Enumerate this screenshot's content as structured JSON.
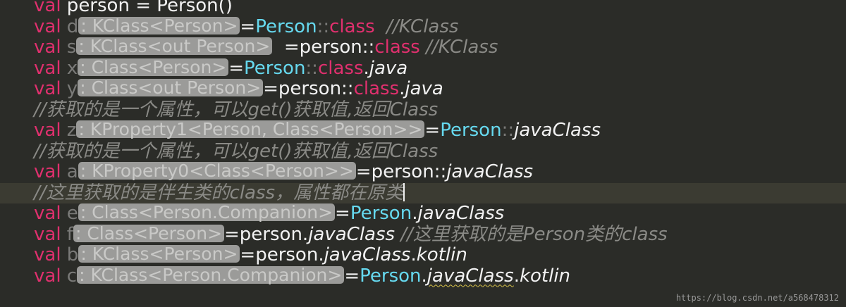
{
  "editor": {
    "lines": [
      {
        "tokens": [
          {
            "t": "val",
            "c": "kw"
          },
          {
            "t": " person = ",
            "c": "op"
          },
          {
            "t": "Person()",
            "c": "op"
          }
        ]
      },
      {
        "tokens": [
          {
            "t": "val",
            "c": "kw"
          },
          {
            "t": " d",
            "c": "dim"
          },
          {
            "t": ": KClass<Person>",
            "c": "hint"
          },
          {
            "t": "=",
            "c": "op"
          },
          {
            "t": "Person",
            "c": "type"
          },
          {
            "t": "::",
            "c": "dim"
          },
          {
            "t": "class",
            "c": "kw"
          },
          {
            "t": "  //KClass",
            "c": "cmt"
          }
        ]
      },
      {
        "tokens": [
          {
            "t": "val",
            "c": "kw"
          },
          {
            "t": " s",
            "c": "dim"
          },
          {
            "t": ": KClass<out Person>",
            "c": "hint"
          },
          {
            "t": "  =person::",
            "c": "op"
          },
          {
            "t": "class",
            "c": "kw"
          },
          {
            "t": " //KClass",
            "c": "cmt"
          }
        ]
      },
      {
        "tokens": [
          {
            "t": "val",
            "c": "kw"
          },
          {
            "t": " x",
            "c": "dim"
          },
          {
            "t": ": Class<Person>",
            "c": "hint"
          },
          {
            "t": "=",
            "c": "op"
          },
          {
            "t": "Person",
            "c": "type"
          },
          {
            "t": "::",
            "c": "dim"
          },
          {
            "t": "class",
            "c": "kw"
          },
          {
            "t": ".",
            "c": "op"
          },
          {
            "t": "java",
            "c": "ital"
          }
        ]
      },
      {
        "tokens": [
          {
            "t": "val",
            "c": "kw"
          },
          {
            "t": " y",
            "c": "dim"
          },
          {
            "t": ": Class<out Person>",
            "c": "hint"
          },
          {
            "t": "=person::",
            "c": "op"
          },
          {
            "t": "class",
            "c": "kw"
          },
          {
            "t": ".",
            "c": "op"
          },
          {
            "t": "java",
            "c": "ital"
          }
        ]
      },
      {
        "tokens": [
          {
            "t": "//获取的是一个属性，可以get()获取值,返回Class",
            "c": "cmt"
          }
        ]
      },
      {
        "tokens": [
          {
            "t": "val",
            "c": "kw"
          },
          {
            "t": " z",
            "c": "dim"
          },
          {
            "t": ": KProperty1<Person, Class<Person>>",
            "c": "hint"
          },
          {
            "t": "=",
            "c": "op"
          },
          {
            "t": "Person",
            "c": "type"
          },
          {
            "t": "::",
            "c": "dim"
          },
          {
            "t": "javaClass",
            "c": "ital"
          }
        ]
      },
      {
        "tokens": [
          {
            "t": "//获取的是一个属性，可以get()获取值,返回Class",
            "c": "cmt"
          }
        ]
      },
      {
        "tokens": [
          {
            "t": "val",
            "c": "kw"
          },
          {
            "t": " a",
            "c": "dim"
          },
          {
            "t": ": KProperty0<Class<Person>>",
            "c": "hint"
          },
          {
            "t": "=person::",
            "c": "op"
          },
          {
            "t": "javaClass",
            "c": "ital"
          }
        ]
      },
      {
        "current": true,
        "caret": true,
        "tokens": [
          {
            "t": "//这里获取的是伴生类的class，属性都在原类",
            "c": "cmt"
          }
        ]
      },
      {
        "tokens": [
          {
            "t": "val",
            "c": "kw"
          },
          {
            "t": " e",
            "c": "dim"
          },
          {
            "t": ": Class<Person.Companion>",
            "c": "hint"
          },
          {
            "t": "=",
            "c": "op"
          },
          {
            "t": "Person",
            "c": "type"
          },
          {
            "t": ".",
            "c": "op"
          },
          {
            "t": "javaClass",
            "c": "ital"
          }
        ]
      },
      {
        "tokens": [
          {
            "t": "val",
            "c": "kw"
          },
          {
            "t": " f",
            "c": "dim"
          },
          {
            "t": ": Class<Person>",
            "c": "hint"
          },
          {
            "t": "=person.",
            "c": "op"
          },
          {
            "t": "javaClass",
            "c": "ital"
          },
          {
            "t": " //这里获取的是Person类的class",
            "c": "cmt"
          }
        ]
      },
      {
        "tokens": [
          {
            "t": "val",
            "c": "kw"
          },
          {
            "t": " b",
            "c": "dim"
          },
          {
            "t": ": KClass<Person>",
            "c": "hint"
          },
          {
            "t": "=person.",
            "c": "op"
          },
          {
            "t": "javaClass",
            "c": "ital"
          },
          {
            "t": ".",
            "c": "op"
          },
          {
            "t": "kotlin",
            "c": "ital"
          }
        ]
      },
      {
        "tokens": [
          {
            "t": "val",
            "c": "kw"
          },
          {
            "t": " c",
            "c": "dim"
          },
          {
            "t": ": KClass<Person.Companion>",
            "c": "hint"
          },
          {
            "t": "=",
            "c": "op"
          },
          {
            "t": "Person",
            "c": "type"
          },
          {
            "t": ".",
            "c": "op"
          },
          {
            "t": "javaClass",
            "c": "ital squig"
          },
          {
            "t": ".",
            "c": "op"
          },
          {
            "t": "kotlin",
            "c": "ital"
          }
        ]
      }
    ]
  },
  "watermark": "https://blog.csdn.net/a568478312",
  "colors": {
    "background": "#2b2c28",
    "keyword": "#e0306e",
    "type": "#66d9ef",
    "comment": "#8a8a86",
    "hint_bg": "#9b9b99"
  }
}
